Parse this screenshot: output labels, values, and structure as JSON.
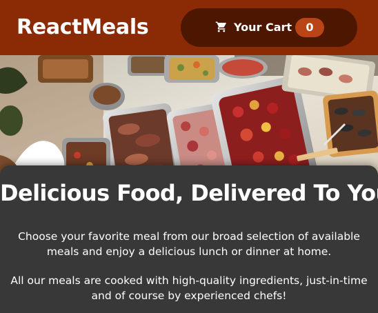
{
  "header": {
    "brand": "ReactMeals",
    "cart": {
      "icon": "shopping-cart-icon",
      "label": "Your Cart",
      "count": "0"
    }
  },
  "hero": {
    "image": "catering-buffet-food-photo"
  },
  "summary": {
    "title": "Delicious Food, Delivered To You",
    "paragraph_1": "Choose your favorite meal from our broad selection of available meals and enjoy a delicious lunch or dinner at home.",
    "paragraph_2": "All our meals are cooked with high-quality ingredients, just-in-time and of course by experienced chefs!"
  },
  "colors": {
    "header_bg": "#8a2b06",
    "cart_button_bg": "#4d1601",
    "badge_bg": "#b94517",
    "card_bg": "#383838",
    "page_bg": "#3f3f3f"
  }
}
